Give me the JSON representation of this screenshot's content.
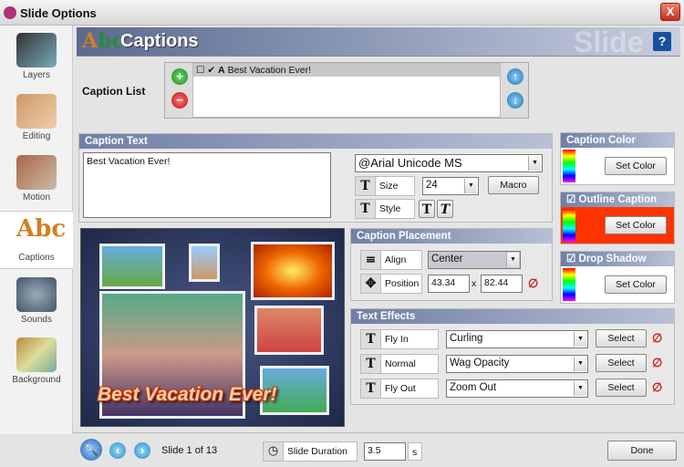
{
  "window": {
    "title": "Slide Options",
    "close": "X"
  },
  "sidebar": {
    "items": [
      {
        "label": "Layers"
      },
      {
        "label": "Editing"
      },
      {
        "label": "Motion"
      },
      {
        "label": "Captions"
      },
      {
        "label": "Sounds"
      },
      {
        "label": "Background"
      }
    ]
  },
  "header": {
    "title": "Captions",
    "watermark": "Slide",
    "help": "?",
    "logo": "ABC"
  },
  "caption_list": {
    "label": "Caption List",
    "items": [
      {
        "text": "Best Vacation Ever!"
      }
    ]
  },
  "caption_text": {
    "title": "Caption Text",
    "value": "Best Vacation Ever!",
    "font": "@Arial Unicode MS",
    "size_label": "Size",
    "size": "24",
    "macro": "Macro",
    "style_label": "Style"
  },
  "caption_color": {
    "title": "Caption Color",
    "button": "Set Color",
    "color": "#ffffff"
  },
  "outline": {
    "title": "Outline Caption",
    "checked": true,
    "button": "Set Color",
    "color": "#ff3300"
  },
  "shadow": {
    "title": "Drop Shadow",
    "checked": true,
    "button": "Set Color",
    "color": "#ffffff"
  },
  "placement": {
    "title": "Caption Placement",
    "align_label": "Align",
    "align": "Center",
    "position_label": "Position",
    "x": "43.34",
    "sep": "x",
    "y": "82.44"
  },
  "effects": {
    "title": "Text Effects",
    "rows": [
      {
        "label": "Fly In",
        "value": "Curling",
        "button": "Select"
      },
      {
        "label": "Normal",
        "value": "Wag Opacity",
        "button": "Select"
      },
      {
        "label": "Fly Out",
        "value": "Zoom Out",
        "button": "Select"
      }
    ]
  },
  "preview": {
    "caption": "Best Vacation Ever!"
  },
  "footer": {
    "slide": "Slide 1 of 13",
    "duration_label": "Slide Duration",
    "duration": "3.5",
    "unit": "s",
    "done": "Done"
  }
}
